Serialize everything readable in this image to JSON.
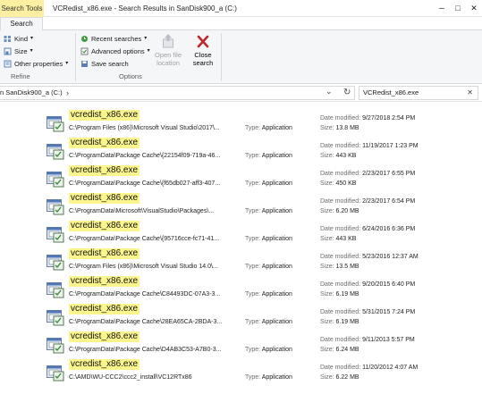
{
  "window": {
    "context_tab": "Search Tools",
    "title": "VCRedist_x86.exe - Search Results in SanDisk900_a (C:)",
    "minimize": "–",
    "maximize": "□",
    "close": "✕"
  },
  "ribbon": {
    "tab_search": "Search",
    "refine": {
      "kind": "Kind",
      "size": "Size",
      "other_properties": "Other properties",
      "group_label": "Refine"
    },
    "options": {
      "recent_searches": "Recent searches",
      "advanced_options": "Advanced options",
      "save_search": "Save search",
      "open_file_location_line1": "Open file",
      "open_file_location_line2": "location",
      "close_search_line1": "Close",
      "close_search_line2": "search",
      "group_label": "Options"
    }
  },
  "address": {
    "path": "n SanDisk900_a (C:)",
    "chevron": "›",
    "dropdown": "⌄",
    "refresh": "↻"
  },
  "search": {
    "value": "VCRedist_x86.exe",
    "clear": "✕"
  },
  "labels": {
    "type": "Type:",
    "date_modified": "Date modified:",
    "size": "Size:"
  },
  "results": [
    {
      "name": "vcredist_x86.exe",
      "path": "C:\\Program Files (x86)\\Microsoft Visual Studio\\2017\\...",
      "type": "Application",
      "date": "9/27/2018 2:54 PM",
      "size": "13.8 MB"
    },
    {
      "name": "vcredist_x86.exe",
      "path": "C:\\ProgramData\\Package Cache\\{22154f09-719a-46...",
      "type": "Application",
      "date": "11/19/2017 1:23 PM",
      "size": "443 KB"
    },
    {
      "name": "vcredist_x86.exe",
      "path": "C:\\ProgramData\\Package Cache\\{f65db027-aff3-407...",
      "type": "Application",
      "date": "2/23/2017 6:55 PM",
      "size": "450 KB"
    },
    {
      "name": "vcredist_x86.exe",
      "path": "C:\\ProgramData\\Microsoft\\VisualStudio\\Packages\\...",
      "type": "Application",
      "date": "2/23/2017 6:54 PM",
      "size": "6.20 MB"
    },
    {
      "name": "vcredist_x86.exe",
      "path": "C:\\ProgramData\\Package Cache\\{95716cce-fc71-41...",
      "type": "Application",
      "date": "6/24/2016 6:36 PM",
      "size": "443 KB"
    },
    {
      "name": "vcredist_x86.exe",
      "path": "C:\\Program Files (x86)\\Microsoft Visual Studio 14.0\\...",
      "type": "Application",
      "date": "5/23/2016 12:37 AM",
      "size": "13.5 MB"
    },
    {
      "name": "vcredist_x86.exe",
      "path": "C:\\ProgramData\\Package Cache\\C84493DC-07A3-3...",
      "type": "Application",
      "date": "9/20/2015 6:40 PM",
      "size": "6.19 MB"
    },
    {
      "name": "vcredist_x86.exe",
      "path": "C:\\ProgramData\\Package Cache\\28EA65CA-2BDA-3...",
      "type": "Application",
      "date": "5/31/2015 7:24 PM",
      "size": "6.19 MB"
    },
    {
      "name": "vcredist_x86.exe",
      "path": "C:\\ProgramData\\Package Cache\\D4AB3C53-A7B0-3...",
      "type": "Application",
      "date": "9/11/2013 5:57 PM",
      "size": "6.24 MB"
    },
    {
      "name": "vcredist_x86.exe",
      "path": "C:\\AMD\\WU-CCC2\\ccc2_install\\VC12RTx86",
      "type": "Application",
      "date": "11/20/2012 4:07 AM",
      "size": "6.22 MB"
    }
  ],
  "colors": {
    "context_tab": "#fcefa1",
    "highlight": "#fbf58e",
    "close_x": "#c0262d",
    "ribbon_bg": "#f5f6f7"
  }
}
